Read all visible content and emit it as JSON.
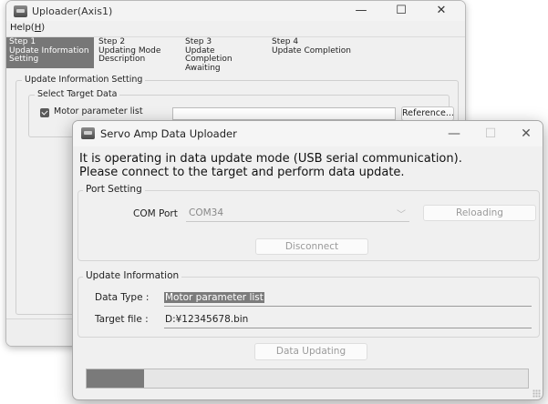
{
  "back_window": {
    "title": "Uploader(Axis1)",
    "menu_help": "Help(H)",
    "menu_help_prefix": "Help(",
    "menu_help_key": "H",
    "menu_help_suffix": ")",
    "steps": [
      {
        "label": "Step 1\nUpdate Information\nSetting",
        "active": true
      },
      {
        "label": "Step 2\nUpdating Mode\nDescription",
        "active": false
      },
      {
        "label": "Step 3\nUpdate Completion\nAwaiting",
        "active": false
      },
      {
        "label": "Step 4\nUpdate Completion",
        "active": false
      }
    ],
    "update_info_group": "Update Information Setting",
    "select_target_group": "Select Target Data",
    "motor_param_checkbox": "Motor parameter list",
    "motor_param_checked": true,
    "path_value": "",
    "reference_button": "Reference..."
  },
  "dialog": {
    "title": "Servo Amp Data Uploader",
    "message_line1": "It is operating in data update mode (USB serial communication).",
    "message_line2": "Please connect to the target and perform data update.",
    "port_setting_group": "Port Setting",
    "com_port_label": "COM Port",
    "com_port_value": "COM34",
    "reloading_button": "Reloading",
    "disconnect_button": "Disconnect",
    "update_info_group": "Update Information",
    "data_type_label": "Data Type :",
    "data_type_value": "Motor parameter list",
    "target_file_label": "Target file :",
    "target_file_value": "D:¥12345678.bin",
    "data_updating_button": "Data Updating",
    "progress_fraction": 0.13
  },
  "icons": {
    "app": "app-icon",
    "minimize": "minimize-icon",
    "maximize": "maximize-icon",
    "close": "close-icon",
    "dropdown": "chevron-down-icon",
    "check": "checkmark-icon"
  }
}
